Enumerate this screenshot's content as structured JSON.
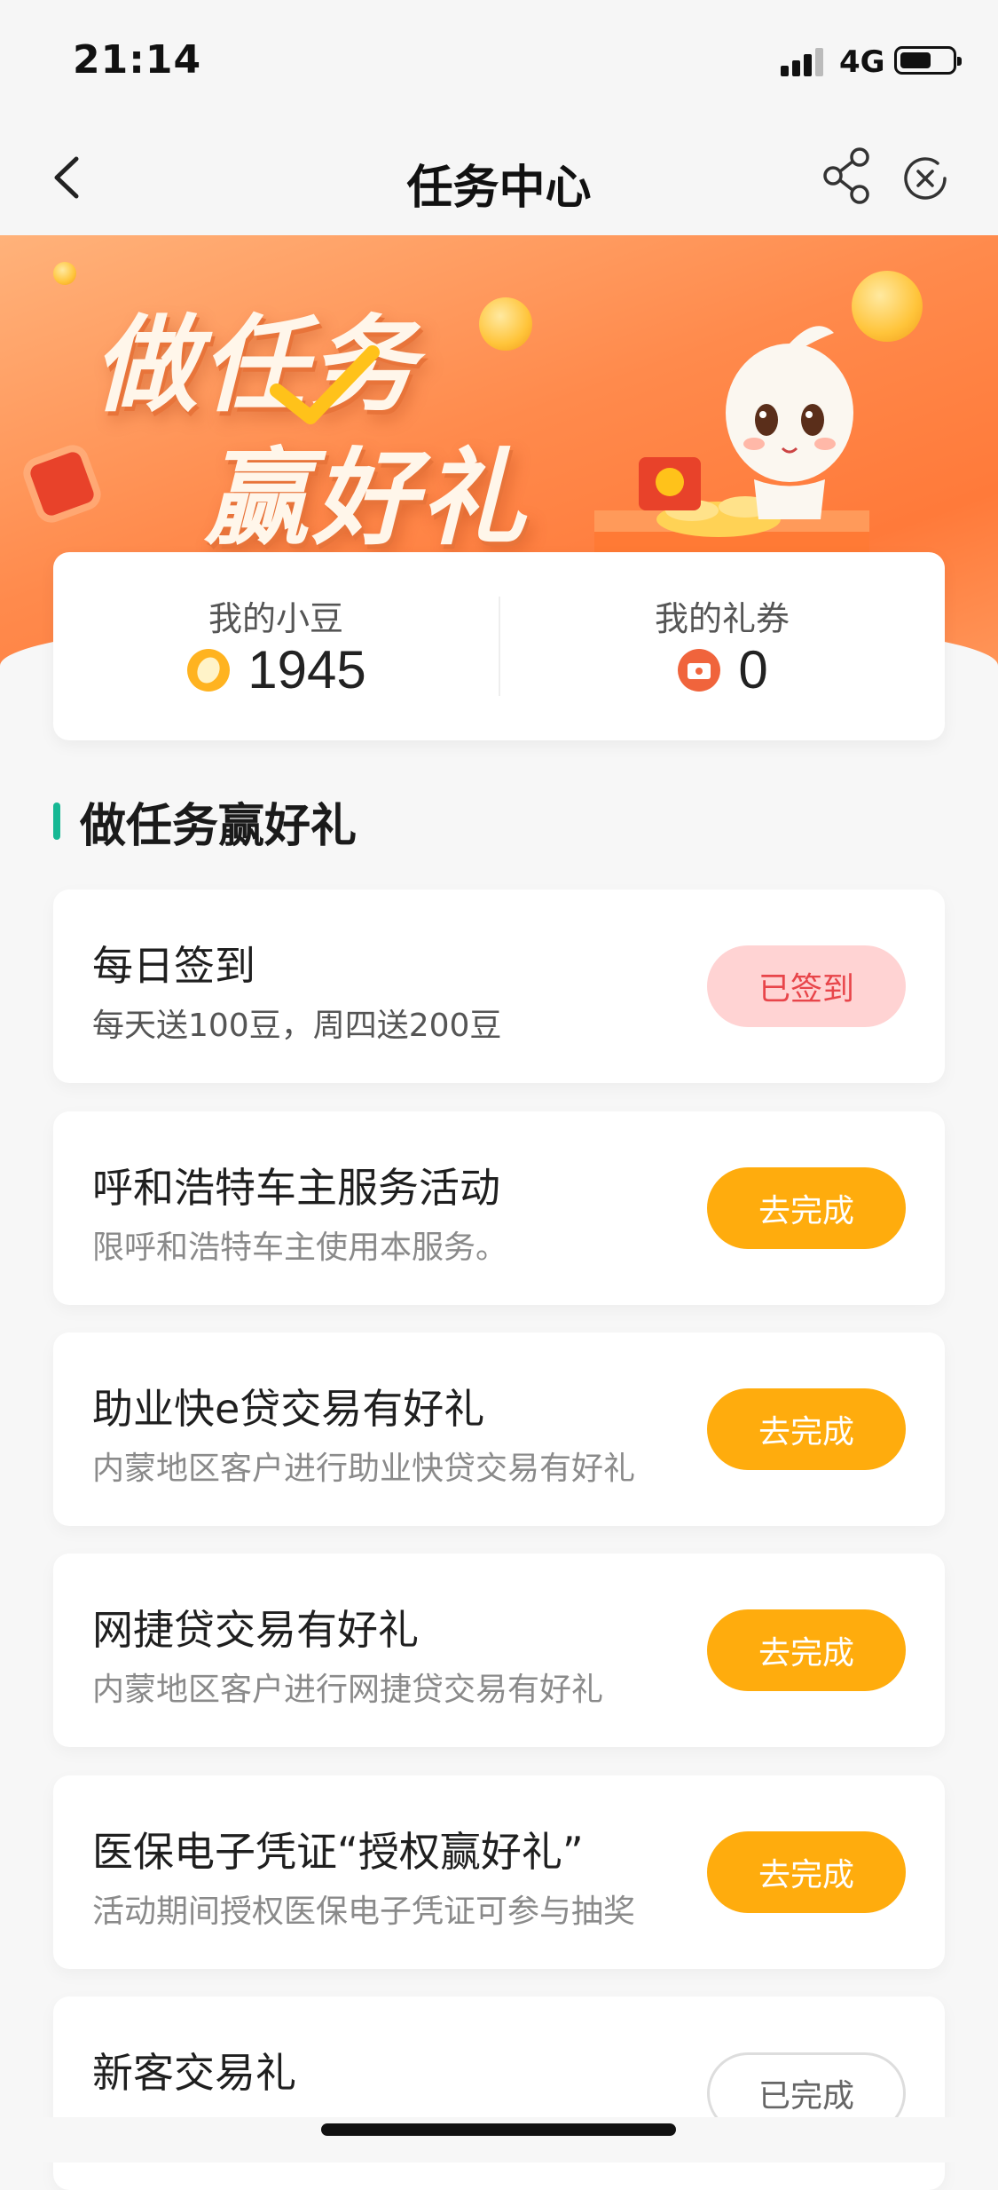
{
  "status_bar": {
    "time": "21:14",
    "network": "4G"
  },
  "nav": {
    "title": "任务中心"
  },
  "banner": {
    "line1": "做任务",
    "line2": "赢好礼"
  },
  "stats": {
    "beans_label": "我的小豆",
    "beans_value": "1945",
    "coupons_label": "我的礼券",
    "coupons_value": "0"
  },
  "section": {
    "title": "做任务赢好礼"
  },
  "tasks": [
    {
      "title": "每日签到",
      "desc": "每天送100豆，周四送200豆",
      "button": "已签到"
    },
    {
      "title": "呼和浩特车主服务活动",
      "desc": "限呼和浩特车主使用本服务。",
      "button": "去完成"
    },
    {
      "title": "助业快e贷交易有好礼",
      "desc": "内蒙地区客户进行助业快贷交易有好礼",
      "button": "去完成"
    },
    {
      "title": "网捷贷交易有好礼",
      "desc": "内蒙地区客户进行网捷贷交易有好礼",
      "button": "去完成"
    },
    {
      "title": "医保电子凭证“授权赢好礼”",
      "desc": "活动期间授权医保电子凭证可参与抽奖",
      "button": "去完成"
    },
    {
      "title": "新客交易礼",
      "desc": "",
      "button": "已完成"
    }
  ],
  "colors": {
    "accent_green": "#16b894",
    "button_orange": "#ffac0d",
    "signed_pink": "#ffd3d3",
    "banner_orange": "#ff8a4c"
  }
}
